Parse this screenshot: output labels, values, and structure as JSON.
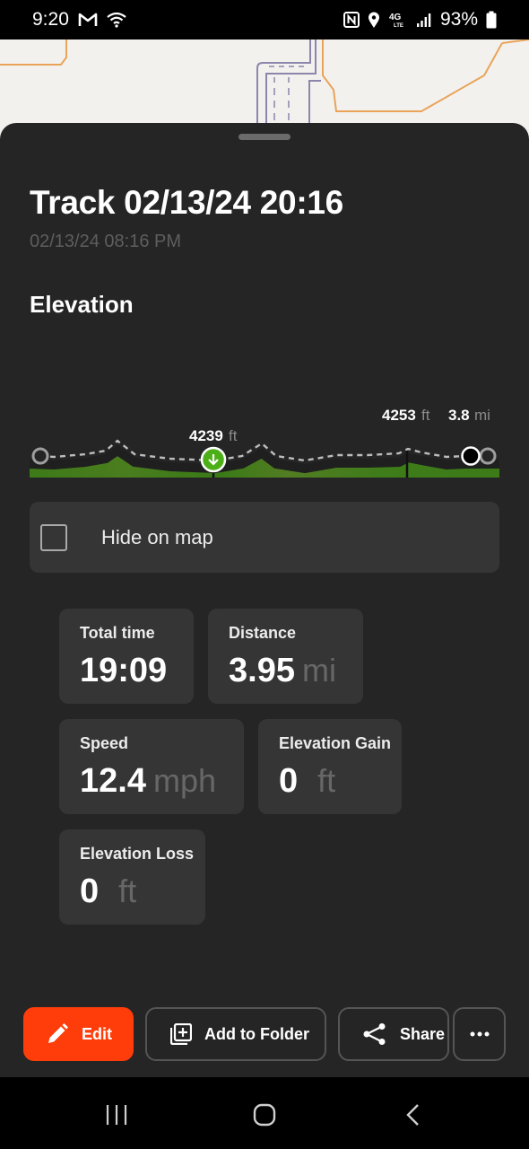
{
  "status_bar": {
    "time": "9:20",
    "battery": "93%",
    "icons": [
      "gmail-icon",
      "wifi-icon",
      "nfc-icon",
      "location-icon",
      "4g-lte-icon",
      "signal-icon",
      "battery-icon"
    ]
  },
  "track": {
    "title": "Track 02/13/24 20:16",
    "subtitle": "02/13/24 08:16 PM"
  },
  "elevation": {
    "heading": "Elevation",
    "min_marker": {
      "value": "4239",
      "unit": "ft"
    },
    "max_marker": {
      "value": "4253",
      "unit": "ft"
    },
    "cursor_marker": {
      "value": "3.8",
      "unit": "mi"
    },
    "colors": {
      "fill": "#3f7d1a",
      "line": "#bdbdbd",
      "min": "#4caf17",
      "max": "#d32f11"
    }
  },
  "hide_on_map": {
    "label": "Hide on map",
    "checked": false
  },
  "stats": {
    "total_time": {
      "label": "Total time",
      "value": "19:09",
      "unit": ""
    },
    "distance": {
      "label": "Distance",
      "value": "3.95",
      "unit": "mi"
    },
    "speed": {
      "label": "Speed",
      "value": "12.4",
      "unit": "mph"
    },
    "elevation_gain": {
      "label": "Elevation Gain",
      "value": "0",
      "unit": "ft"
    },
    "elevation_loss": {
      "label": "Elevation Loss",
      "value": "0",
      "unit": "ft"
    }
  },
  "actions": {
    "edit": "Edit",
    "add_to_folder": "Add to Folder",
    "share": "Share",
    "more": "more-icon"
  },
  "colors": {
    "accent": "#ff3d0a",
    "sheet": "#252525",
    "card": "#353535"
  }
}
